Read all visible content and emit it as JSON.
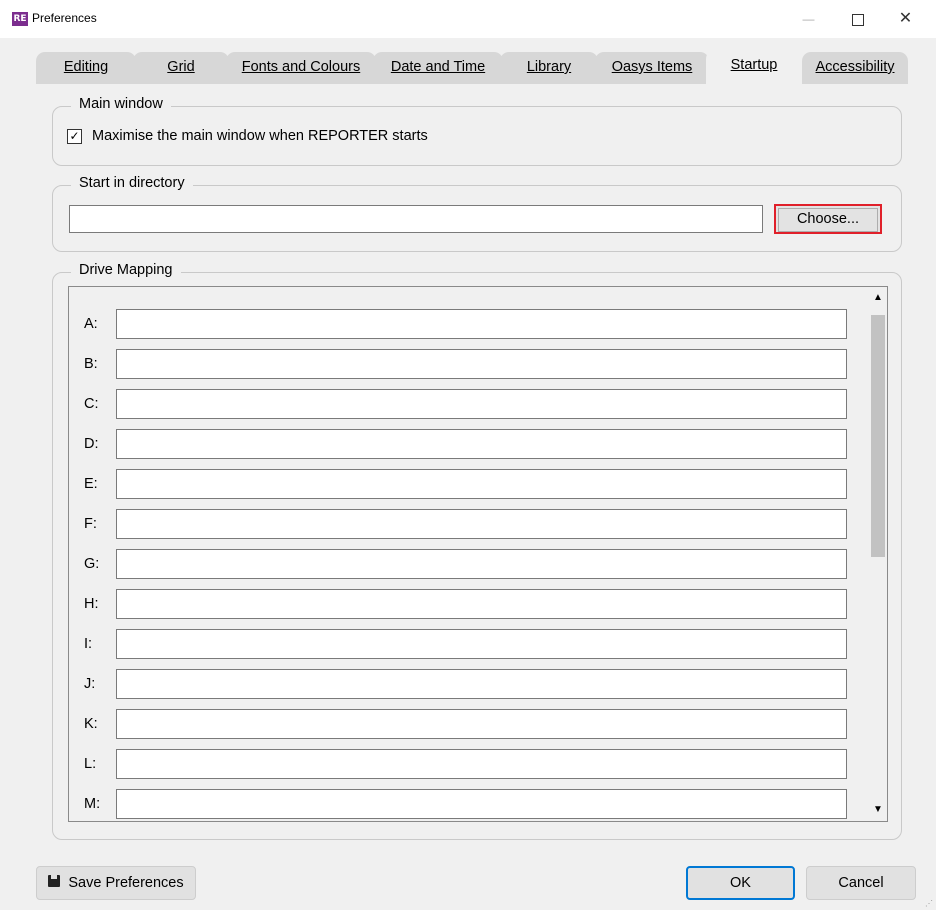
{
  "window": {
    "app_icon_text": "RE",
    "title": "Preferences",
    "minimize_glyph": "—",
    "close_glyph": "✕"
  },
  "tabs": [
    {
      "label": "Editing"
    },
    {
      "label": "Grid"
    },
    {
      "label": "Fonts and Colours"
    },
    {
      "label": "Date and Time"
    },
    {
      "label": "Library"
    },
    {
      "label": "Oasys Items"
    },
    {
      "label": "Startup"
    },
    {
      "label": "Accessibility"
    }
  ],
  "main_window": {
    "legend": "Main window",
    "maximise_label": "Maximise the main window when REPORTER starts",
    "maximise_checked": true
  },
  "start_dir": {
    "legend": "Start in directory",
    "value": "",
    "choose_label": "Choose..."
  },
  "drives": {
    "legend": "Drive Mapping",
    "items": [
      {
        "label": "A:",
        "value": ""
      },
      {
        "label": "B:",
        "value": ""
      },
      {
        "label": "C:",
        "value": ""
      },
      {
        "label": "D:",
        "value": ""
      },
      {
        "label": "E:",
        "value": ""
      },
      {
        "label": "F:",
        "value": ""
      },
      {
        "label": "G:",
        "value": ""
      },
      {
        "label": "H:",
        "value": ""
      },
      {
        "label": "I:",
        "value": ""
      },
      {
        "label": "J:",
        "value": ""
      },
      {
        "label": "K:",
        "value": ""
      },
      {
        "label": "L:",
        "value": ""
      },
      {
        "label": "M:",
        "value": ""
      }
    ]
  },
  "footer": {
    "save_label": "Save Preferences",
    "ok_label": "OK",
    "cancel_label": "Cancel"
  },
  "colors": {
    "highlight": "#e0202a",
    "ok_border": "#0078d4",
    "app_icon": "#7b2d8e"
  }
}
